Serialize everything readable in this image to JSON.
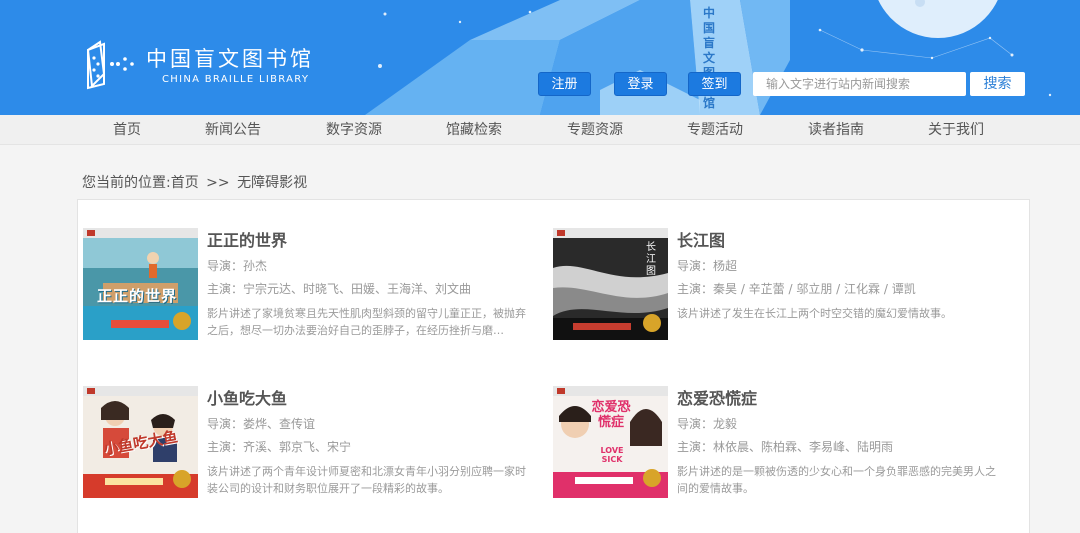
{
  "brand": {
    "name_cn": "中国盲文图书馆",
    "name_en": "CHINA BRAILLE LIBRARY"
  },
  "header_buttons": {
    "register": "注册",
    "login": "登录",
    "signin": "签到"
  },
  "header_deco_text": "中国盲文图书馆",
  "search": {
    "placeholder": "输入文字进行站内新闻搜索",
    "button": "搜索"
  },
  "nav": [
    "首页",
    "新闻公告",
    "数字资源",
    "馆藏检索",
    "专题资源",
    "专题活动",
    "读者指南",
    "关于我们"
  ],
  "breadcrumb": {
    "prefix": "您当前的位置:",
    "home": "首页",
    "separator": ">>",
    "current": "无障碍影视"
  },
  "movies": [
    {
      "title": "正正的世界",
      "director": "导演：孙杰",
      "cast": "主演：宁宗元达、时晓飞、田媛、王海洋、刘文曲",
      "desc": "影片讲述了家境贫寒且先天性肌肉型斜颈的留守儿童正正，被抛弃之后，想尽一切办法要治好自己的歪脖子，在经历挫折与磨…",
      "poster_text": "正正的世界"
    },
    {
      "title": "长江图",
      "director": "导演：杨超",
      "cast": "主演：秦昊 / 辛芷蕾 / 邬立朋 / 江化霖 / 谭凯",
      "desc": "该片讲述了发生在长江上两个时空交错的魔幻爱情故事。",
      "poster_text": "长江图"
    },
    {
      "title": "小鱼吃大鱼",
      "director": "导演：娄烨、查传谊",
      "cast": "主演：齐溪、郭京飞、宋宁",
      "desc": "该片讲述了两个青年设计师夏密和北漂女青年小羽分别应聘一家时装公司的设计和财务职位展开了一段精彩的故事。",
      "poster_text": "小鱼吃大鱼"
    },
    {
      "title": "恋爱恐慌症",
      "director": "导演：龙毅",
      "cast": "主演：林依晨、陈柏霖、李易峰、陆明雨",
      "desc": "影片讲述的是一颗被伤透的少女心和一个身负罪恶感的完美男人之间的爱情故事。",
      "poster_text": "恋爱恐慌症",
      "poster_text_en": "LOVE SICK"
    }
  ]
}
